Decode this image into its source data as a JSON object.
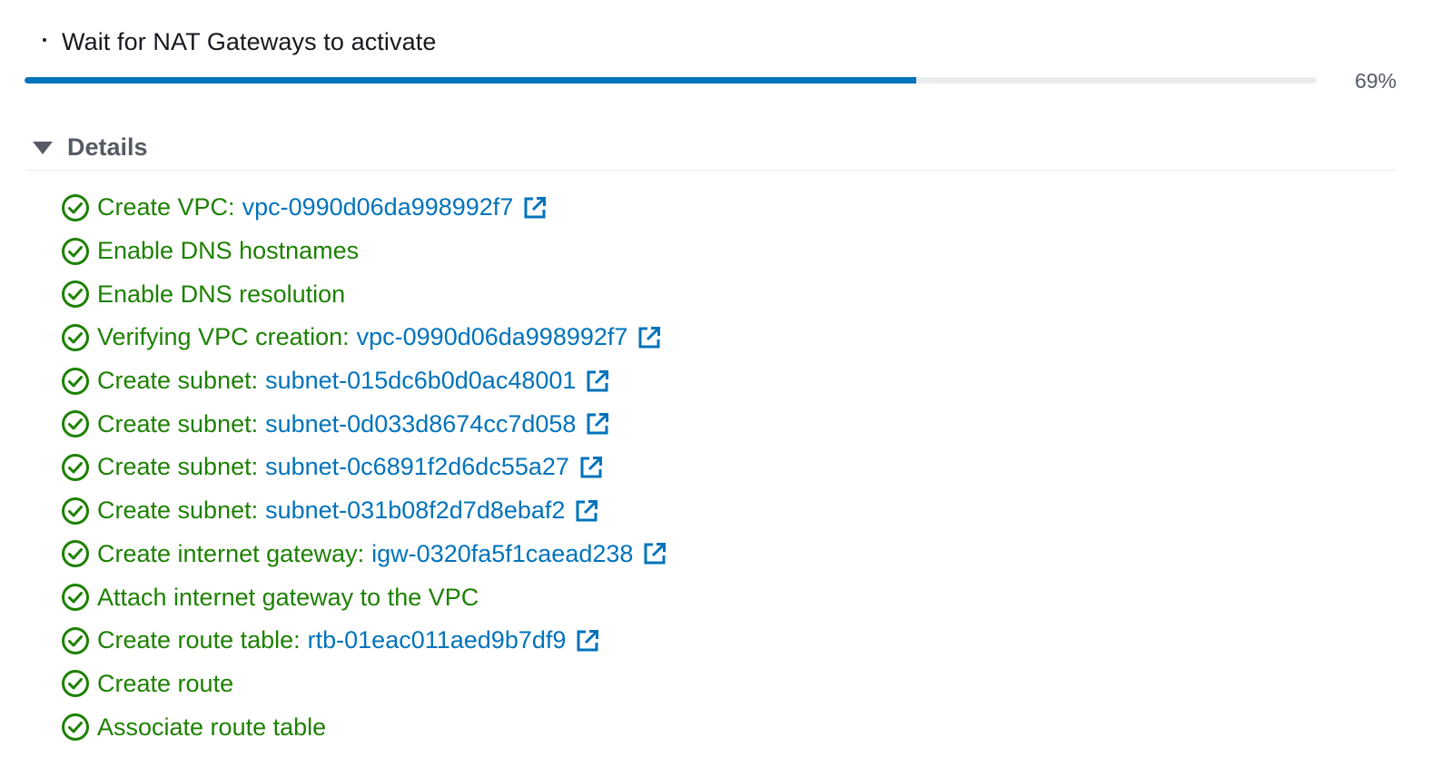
{
  "header": {
    "title": "Wait for NAT Gateways to activate"
  },
  "progress": {
    "value": 0.69,
    "label": "69%"
  },
  "details": {
    "label": "Details",
    "expanded": true
  },
  "colors": {
    "success": "#1d8102",
    "link": "#0073bb",
    "progress": "#0073bb",
    "muted": "#545b64"
  },
  "steps": [
    {
      "label": "Create VPC:",
      "link": "vpc-0990d06da998992f7"
    },
    {
      "label": "Enable DNS hostnames",
      "link": null
    },
    {
      "label": "Enable DNS resolution",
      "link": null
    },
    {
      "label": "Verifying VPC creation:",
      "link": "vpc-0990d06da998992f7"
    },
    {
      "label": "Create subnet:",
      "link": "subnet-015dc6b0d0ac48001"
    },
    {
      "label": "Create subnet:",
      "link": "subnet-0d033d8674cc7d058"
    },
    {
      "label": "Create subnet:",
      "link": "subnet-0c6891f2d6dc55a27"
    },
    {
      "label": "Create subnet:",
      "link": "subnet-031b08f2d7d8ebaf2"
    },
    {
      "label": "Create internet gateway:",
      "link": "igw-0320fa5f1caead238"
    },
    {
      "label": "Attach internet gateway to the VPC",
      "link": null
    },
    {
      "label": "Create route table:",
      "link": "rtb-01eac011aed9b7df9"
    },
    {
      "label": "Create route",
      "link": null
    },
    {
      "label": "Associate route table",
      "link": null
    }
  ],
  "icons": {
    "status": "check-circle-icon",
    "external": "external-link-icon",
    "spinner": "spinner-icon",
    "caret": "caret-down-icon"
  }
}
